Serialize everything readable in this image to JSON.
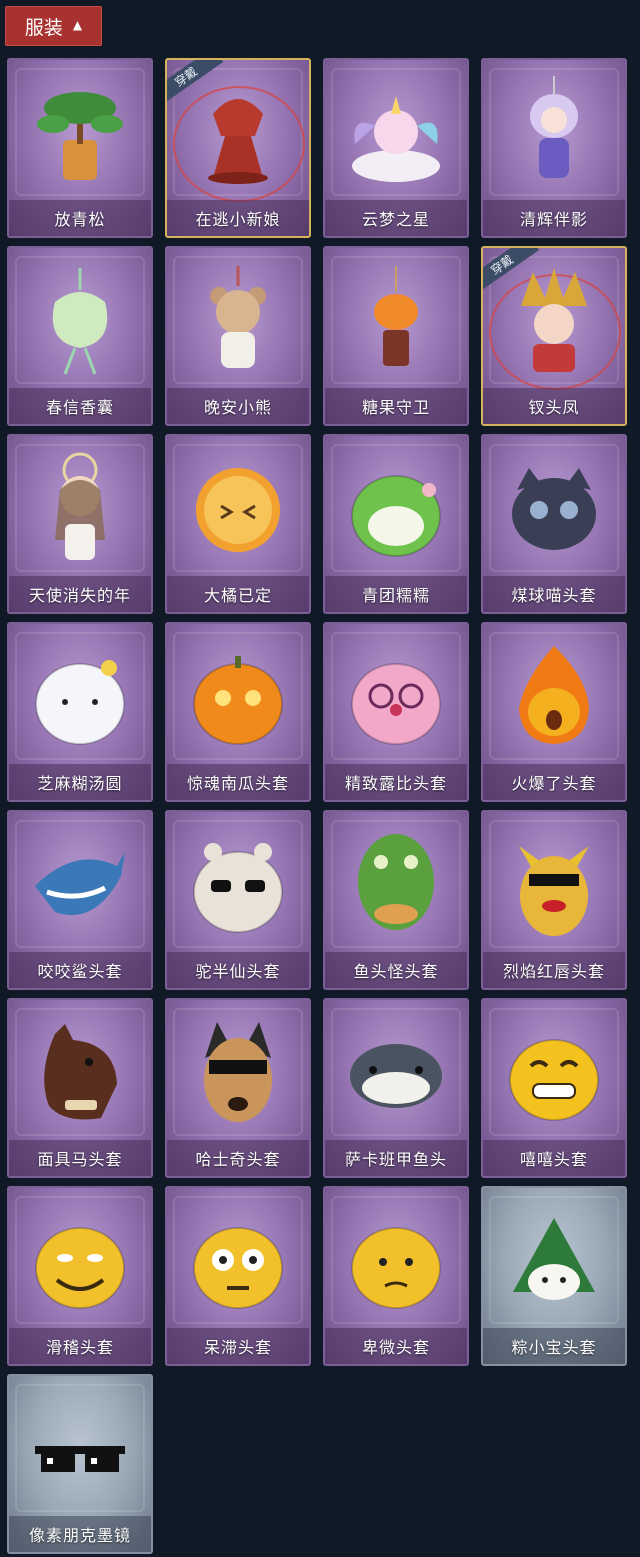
{
  "section": {
    "label": "服装",
    "chevron_icon": "chevron-up-icon"
  },
  "badge_label": "穿戴",
  "items": [
    {
      "name": "放青松",
      "equipped": false,
      "variant": "purple",
      "icon": "bonsai-tree-icon"
    },
    {
      "name": "在逃小新娘",
      "equipped": true,
      "variant": "purple",
      "icon": "bride-veil-icon"
    },
    {
      "name": "云梦之星",
      "equipped": false,
      "variant": "purple",
      "icon": "unicorn-cloud-icon"
    },
    {
      "name": "清辉伴影",
      "equipped": false,
      "variant": "purple",
      "icon": "doll-charm-icon"
    },
    {
      "name": "春信香囊",
      "equipped": false,
      "variant": "purple",
      "icon": "sachet-icon"
    },
    {
      "name": "晚安小熊",
      "equipped": false,
      "variant": "purple",
      "icon": "teddy-bear-icon"
    },
    {
      "name": "糖果守卫",
      "equipped": false,
      "variant": "purple",
      "icon": "pumpkin-guard-icon"
    },
    {
      "name": "钗头凤",
      "equipped": true,
      "variant": "purple",
      "icon": "phoenix-crown-icon"
    },
    {
      "name": "天使消失的年",
      "equipped": false,
      "variant": "purple",
      "icon": "angel-girl-icon"
    },
    {
      "name": "大橘已定",
      "equipped": false,
      "variant": "purple",
      "icon": "orange-slice-icon"
    },
    {
      "name": "青团糯糯",
      "equipped": false,
      "variant": "purple",
      "icon": "green-rice-ball-icon"
    },
    {
      "name": "煤球喵头套",
      "equipped": false,
      "variant": "purple",
      "icon": "black-cat-head-icon"
    },
    {
      "name": "芝麻糊汤圆",
      "equipped": false,
      "variant": "purple",
      "icon": "rice-dumpling-icon"
    },
    {
      "name": "惊魂南瓜头套",
      "equipped": false,
      "variant": "purple",
      "icon": "jack-o-lantern-icon"
    },
    {
      "name": "精致露比头套",
      "equipped": false,
      "variant": "purple",
      "icon": "pink-beaver-icon"
    },
    {
      "name": "火爆了头套",
      "equipped": false,
      "variant": "purple",
      "icon": "fire-head-icon"
    },
    {
      "name": "咬咬鲨头套",
      "equipped": false,
      "variant": "purple",
      "icon": "shark-head-icon"
    },
    {
      "name": "驼半仙头套",
      "equipped": false,
      "variant": "purple",
      "icon": "alpaca-sunglasses-icon"
    },
    {
      "name": "鱼头怪头套",
      "equipped": false,
      "variant": "purple",
      "icon": "fish-mask-icon"
    },
    {
      "name": "烈焰红唇头套",
      "equipped": false,
      "variant": "purple",
      "icon": "yellow-mask-sunglasses-icon"
    },
    {
      "name": "面具马头套",
      "equipped": false,
      "variant": "purple",
      "icon": "horse-mask-icon"
    },
    {
      "name": "哈士奇头套",
      "equipped": false,
      "variant": "purple",
      "icon": "husky-head-icon"
    },
    {
      "name": "萨卡班甲鱼头",
      "equipped": false,
      "variant": "purple",
      "icon": "fish-head-icon"
    },
    {
      "name": "嘻嘻头套",
      "equipped": false,
      "variant": "purple",
      "icon": "grin-emoji-icon"
    },
    {
      "name": "滑稽头套",
      "equipped": false,
      "variant": "purple",
      "icon": "funny-emoji-icon"
    },
    {
      "name": "呆滞头套",
      "equipped": false,
      "variant": "purple",
      "icon": "dazed-emoji-icon"
    },
    {
      "name": "卑微头套",
      "equipped": false,
      "variant": "purple",
      "icon": "humble-emoji-icon"
    },
    {
      "name": "粽小宝头套",
      "equipped": false,
      "variant": "grey",
      "icon": "zongzi-head-icon"
    },
    {
      "name": "像素朋克墨镜",
      "equipped": false,
      "variant": "grey",
      "icon": "pixel-sunglasses-icon"
    }
  ],
  "colors": {
    "background": "#0f1a26",
    "tab": "#a8322f",
    "card_purple": "#9777b4",
    "card_grey": "#9aa8b6",
    "equipped_border": "#d6b25a"
  }
}
